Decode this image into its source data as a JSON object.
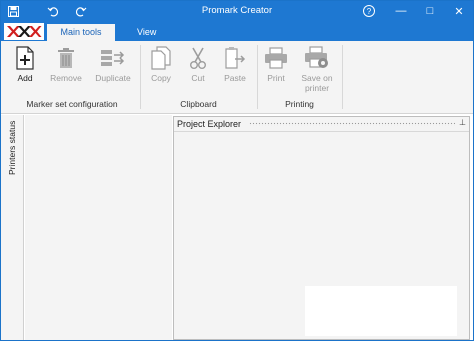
{
  "window": {
    "title": "Promark Creator",
    "accent": "#1e78d2",
    "help_glyph": "?",
    "minimize_glyph": "—",
    "maximize_glyph": "□",
    "close_glyph": "✕"
  },
  "quick_access": [
    {
      "name": "save-icon"
    },
    {
      "name": "undo-icon"
    },
    {
      "name": "redo-icon"
    }
  ],
  "tabs": [
    {
      "label": "Main tools",
      "active": true
    },
    {
      "label": "View",
      "active": false
    }
  ],
  "ribbon": {
    "groups": [
      {
        "label": "Marker set configuration"
      },
      {
        "label": "Clipboard"
      },
      {
        "label": "Printing"
      }
    ],
    "buttons": {
      "add": {
        "label": "Add",
        "enabled": true,
        "icon": "add-file-icon"
      },
      "remove": {
        "label": "Remove",
        "enabled": false,
        "icon": "trash-icon"
      },
      "duplicate": {
        "label": "Duplicate",
        "enabled": false,
        "icon": "duplicate-icon"
      },
      "copy": {
        "label": "Copy",
        "enabled": false,
        "icon": "copy-icon"
      },
      "cut": {
        "label": "Cut",
        "enabled": false,
        "icon": "scissors-icon"
      },
      "paste": {
        "label": "Paste",
        "enabled": false,
        "icon": "paste-icon"
      },
      "print": {
        "label": "Print",
        "enabled": false,
        "icon": "printer-icon"
      },
      "save_on_printer": {
        "label_line1": "Save on",
        "label_line2": "printer",
        "enabled": false,
        "icon": "printer-gear-icon"
      }
    }
  },
  "side_panel": {
    "label": "Printers status"
  },
  "explorer": {
    "title": "Project Explorer",
    "pin_glyph": "⊥"
  }
}
